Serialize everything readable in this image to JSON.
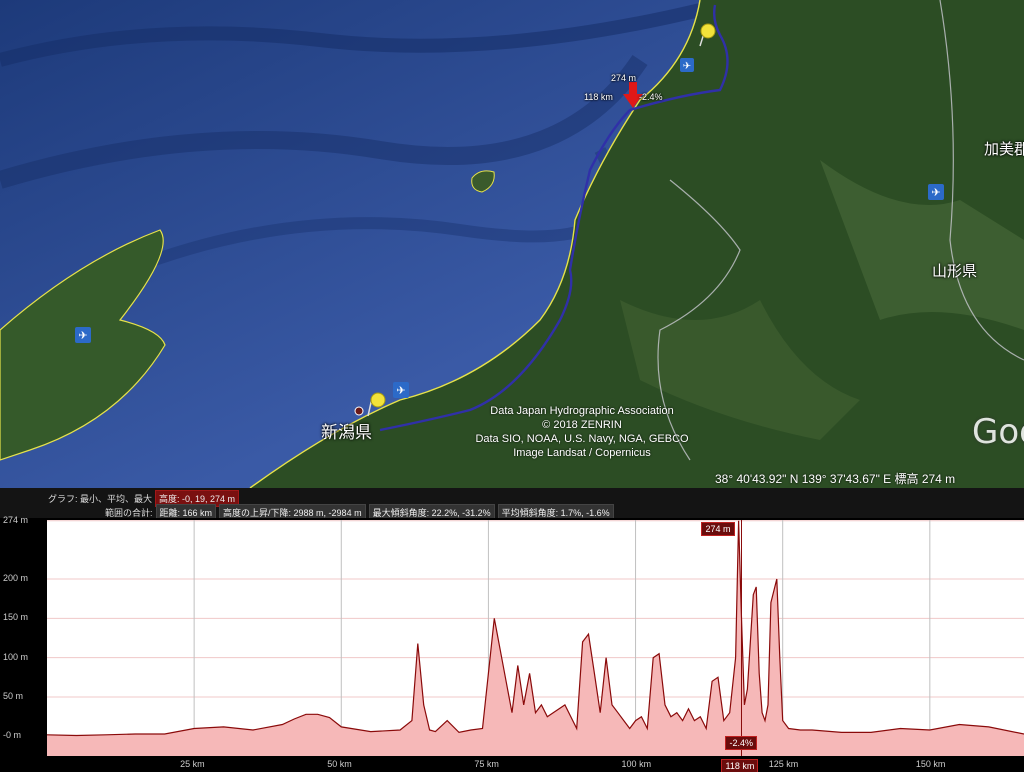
{
  "map": {
    "labels": {
      "niigata": "新潟県",
      "yamagata": "山形県",
      "kamo": "加美郡"
    },
    "attribution": [
      "Data Japan Hydrographic Association",
      "© 2018 ZENRIN",
      "Data SIO, NOAA, U.S. Navy, NGA, GEBCO",
      "Image Landsat / Copernicus"
    ],
    "status": {
      "coords": "38° 40'43.92\" N  139° 37'43.67\" E  標高   274 m"
    },
    "brand": "Goo",
    "marker": {
      "elevation": "274 m",
      "distance": "118 km",
      "slope": "-2.4%"
    },
    "colors": {
      "sea": "#2f4f9a",
      "land": "#2c4d24",
      "route": "#3030a8",
      "coast": "#e6e24a",
      "arrow": "#e01818"
    }
  },
  "graph_header": {
    "row1_label": "グラフ: 最小、平均、最大",
    "row1_value": "高度: -0, 19, 274 m",
    "row2_label": "範囲の合計:",
    "distance": "距離: 166 km",
    "updown": "高度の上昇/下降: 2988 m, -2984 m",
    "max_slope": "最大傾斜角度: 22.2%, -31.2%",
    "avg_slope": "平均傾斜角度: 1.7%, -1.6%"
  },
  "chart_data": {
    "type": "area",
    "xlabel": "",
    "ylabel": "",
    "xlim": [
      0,
      166
    ],
    "ylim": [
      -25,
      275
    ],
    "yticks": [
      "274 m",
      "200 m",
      "150 m",
      "100 m",
      "50 m",
      "-0 m"
    ],
    "ytick_values": [
      274,
      200,
      150,
      100,
      50,
      0
    ],
    "xticks": [
      "25 km",
      "50 km",
      "75 km",
      "100 km",
      "125 km",
      "150 km"
    ],
    "xtick_values": [
      25,
      50,
      75,
      100,
      125,
      150
    ],
    "selected_x_label": "118 km",
    "selected_elevation": "274 m",
    "selected_slope": "-2.4%",
    "selected_x": 118,
    "series": [
      {
        "x": [
          0,
          5,
          10,
          15,
          20,
          25,
          30,
          35,
          40,
          42,
          44,
          46,
          48,
          50,
          55,
          60,
          62,
          63,
          64,
          65,
          66,
          68,
          70,
          72,
          74,
          75,
          76,
          77,
          78,
          79,
          80,
          81,
          82,
          83,
          84,
          85,
          86,
          88,
          90,
          91,
          92,
          93,
          94,
          95,
          96,
          97,
          98,
          99,
          100,
          101,
          102,
          103,
          104,
          105,
          106,
          107,
          108,
          109,
          110,
          111,
          112,
          113,
          114,
          115,
          116,
          117,
          117.5,
          118,
          118.5,
          119,
          120,
          120.5,
          121,
          121.5,
          122,
          122.5,
          123,
          124,
          124.5,
          125,
          126,
          128,
          130,
          135,
          140,
          145,
          150,
          155,
          160,
          166
        ],
        "values": [
          2,
          1,
          2,
          3,
          3,
          10,
          12,
          8,
          15,
          22,
          28,
          28,
          24,
          12,
          6,
          8,
          20,
          118,
          40,
          8,
          6,
          20,
          5,
          8,
          10,
          80,
          150,
          110,
          70,
          30,
          90,
          40,
          80,
          30,
          40,
          25,
          30,
          40,
          10,
          120,
          130,
          80,
          30,
          100,
          40,
          30,
          20,
          10,
          20,
          25,
          10,
          100,
          105,
          40,
          25,
          30,
          20,
          35,
          20,
          25,
          10,
          70,
          75,
          20,
          30,
          100,
          274,
          150,
          40,
          60,
          180,
          190,
          80,
          30,
          20,
          40,
          170,
          200,
          100,
          20,
          10,
          8,
          8,
          5,
          5,
          10,
          8,
          15,
          12,
          3
        ]
      }
    ]
  }
}
